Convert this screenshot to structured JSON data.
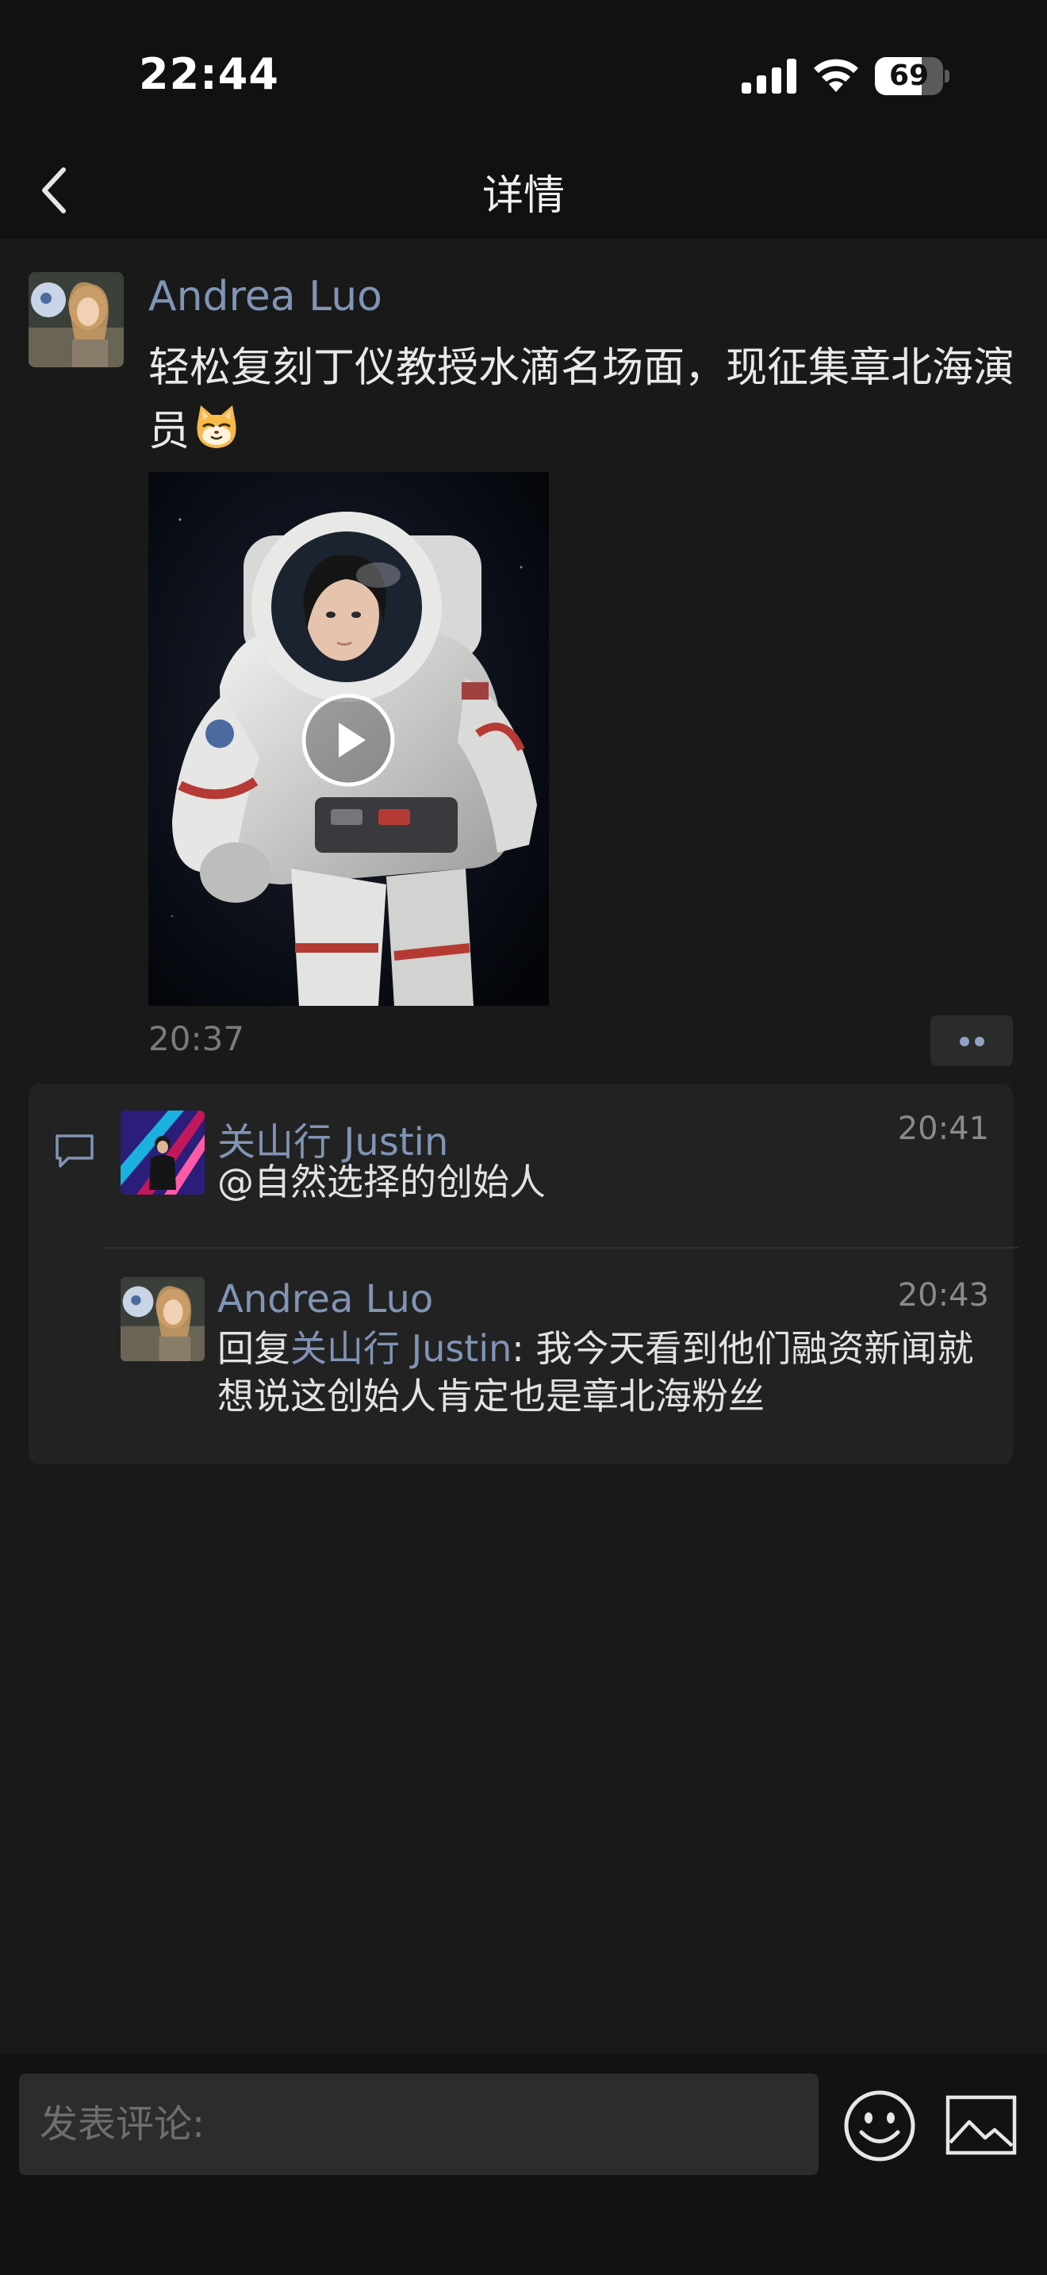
{
  "status_bar": {
    "time": "22:44",
    "battery_percent": "69",
    "battery_level": 0.69,
    "icons": [
      "cellular-signal-icon",
      "wifi-icon",
      "battery-icon"
    ]
  },
  "nav": {
    "title": "详情",
    "back_icon": "chevron-left-icon"
  },
  "post": {
    "author": "Andrea Luo",
    "text": "轻松复刻丁仪教授水滴名场面，现征集章北海演员",
    "emoji": "cat-face-emoji",
    "media": "video",
    "play_icon": "play-icon",
    "time": "20:37",
    "more_icon": "more-dots-icon"
  },
  "comments": {
    "icon": "comment-bubble-icon",
    "items": [
      {
        "author": "关山行 Justin",
        "time": "20:41",
        "text": "@自然选择的创始人"
      },
      {
        "author": "Andrea Luo",
        "time": "20:43",
        "reply_prefix": "回复",
        "reply_to": "关山行 Justin",
        "text": ": 我今天看到他们融资新闻就想说这创始人肯定也是章北海粉丝"
      }
    ]
  },
  "input": {
    "placeholder": "发表评论:",
    "emoji_icon": "smiley-icon",
    "image_icon": "image-icon"
  },
  "colors": {
    "background": "#191919",
    "bar": "#111111",
    "link_blue": "#8094b5",
    "panel": "#222222"
  }
}
